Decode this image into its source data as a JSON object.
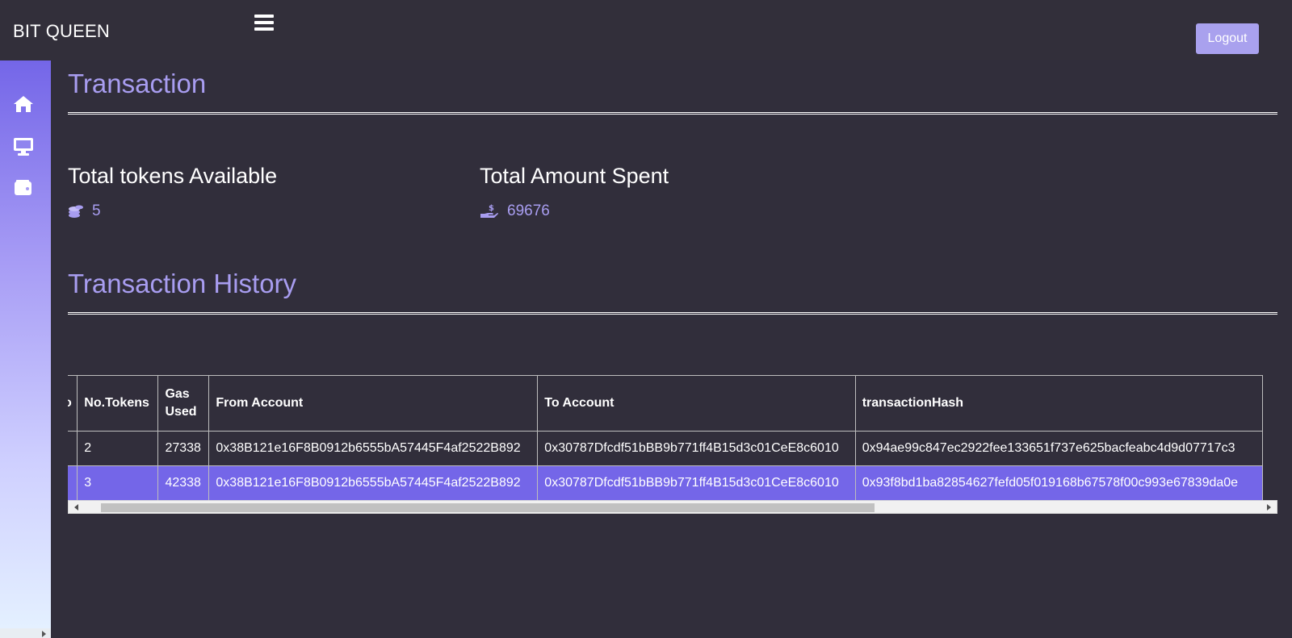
{
  "app": {
    "brand": "BIT QUEEN",
    "logout_label": "Logout"
  },
  "sidebar": {
    "items": [
      {
        "icon": "home-icon"
      },
      {
        "icon": "desktop-icon"
      },
      {
        "icon": "wallet-icon"
      }
    ]
  },
  "transaction": {
    "title": "Transaction",
    "tokens_label": "Total tokens Available",
    "tokens_value": "5",
    "spent_label": "Total Amount Spent",
    "spent_value": "69676"
  },
  "history": {
    "title": "Transaction History",
    "columns": [
      "o",
      "No.Tokens",
      "Gas Used",
      "From Account",
      "To Account",
      "transactionHash"
    ],
    "rows": [
      {
        "no": "",
        "tokens": "2",
        "gas": "27338",
        "from": "0x38B121e16F8B0912b6555bA57445F4af2522B892",
        "to": "0x30787Dfcdf51bBB9b771ff4B15d3c01CeE8c6010",
        "hash": "0x94ae99c847ec2922fee133651f737e625bacfeabc4d9d07717c3"
      },
      {
        "no": "",
        "tokens": "3",
        "gas": "42338",
        "from": "0x38B121e16F8B0912b6555bA57445F4af2522B892",
        "to": "0x30787Dfcdf51bBB9b771ff4B15d3c01CeE8c6010",
        "hash": "0x93f8bd1ba82854627fefd05f019168b67578f00c993e67839da0e"
      }
    ]
  },
  "colors": {
    "background": "#312e3b",
    "accent": "#a89df0",
    "highlight_row": "#7466e8"
  }
}
